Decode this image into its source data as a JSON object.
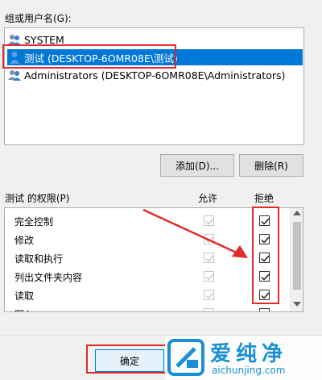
{
  "groups_label": "组或用户名(G):",
  "users": [
    {
      "name": "SYSTEM",
      "icon": "users-group-icon",
      "selected": false
    },
    {
      "name": "测试 (DESKTOP-6OMR08E\\测试)",
      "icon": "user-icon",
      "selected": true
    },
    {
      "name": "Administrators (DESKTOP-6OMR08E\\Administrators)",
      "icon": "users-group-icon",
      "selected": false
    }
  ],
  "buttons": {
    "add": "添加(D)...",
    "remove": "删除(R)",
    "ok": "确定"
  },
  "permissions": {
    "header": "测试 的权限(P)",
    "allow_label": "允许",
    "deny_label": "拒绝",
    "rows": [
      {
        "name": "完全控制",
        "allow": true,
        "deny": true
      },
      {
        "name": "修改",
        "allow": true,
        "deny": true
      },
      {
        "name": "读取和执行",
        "allow": true,
        "deny": true
      },
      {
        "name": "列出文件夹内容",
        "allow": true,
        "deny": true
      },
      {
        "name": "读取",
        "allow": true,
        "deny": true
      },
      {
        "name": "写入",
        "allow": true,
        "deny": false
      }
    ]
  },
  "watermark": {
    "brand": "爱纯净",
    "url": "aichunjing.com"
  },
  "colors": {
    "selection": "#0078d7",
    "highlight": "#e02b2b",
    "background": "#f0f0f0"
  }
}
